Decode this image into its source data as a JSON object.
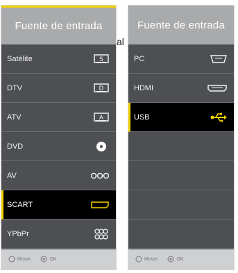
{
  "left": {
    "title": "Fuente de entrada",
    "items": [
      {
        "label": "Satélite",
        "icon": "satellite-s-icon"
      },
      {
        "label": "DTV",
        "icon": "dtv-d-icon"
      },
      {
        "label": "ATV",
        "icon": "atv-a-icon"
      },
      {
        "label": "DVD",
        "icon": "disc-icon"
      },
      {
        "label": "AV",
        "icon": "av-connectors-icon"
      },
      {
        "label": "SCART",
        "icon": "scart-connector-icon",
        "selected": true
      },
      {
        "label": "YPbPr",
        "icon": "component-connectors-icon"
      }
    ],
    "footer": {
      "move": "Mover",
      "ok": "OK"
    }
  },
  "right": {
    "title": "Fuente de entrada",
    "items": [
      {
        "label": "PC",
        "icon": "vga-connector-icon"
      },
      {
        "label": "HDMI",
        "icon": "hdmi-connector-icon"
      },
      {
        "label": "USB",
        "icon": "usb-icon",
        "selected": true
      }
    ],
    "footer": {
      "move": "Mover",
      "ok": "OK"
    }
  },
  "stray_text": "al",
  "colors": {
    "accent": "#f2d200",
    "panel_bg": "#4e4f52",
    "header_bg": "#a9aaab",
    "selected_bg": "#000000"
  }
}
